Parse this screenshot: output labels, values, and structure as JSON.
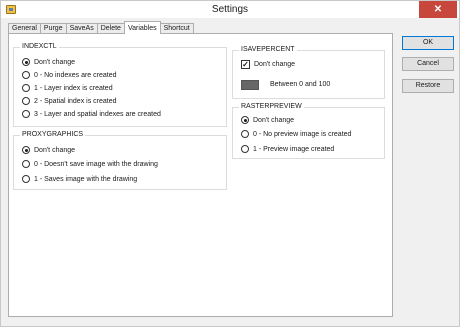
{
  "window": {
    "title": "Settings",
    "close_glyph": "✕",
    "app_icon": "settings-app-icon"
  },
  "tabs": [
    {
      "label": "General",
      "active": false
    },
    {
      "label": "Purge",
      "active": false
    },
    {
      "label": "SaveAs",
      "active": false
    },
    {
      "label": "Delete",
      "active": false
    },
    {
      "label": "Variables",
      "active": true
    },
    {
      "label": "Shortcut",
      "active": false
    }
  ],
  "indexctl": {
    "title": "INDEXCTL",
    "options": [
      {
        "label": "Don't change",
        "checked": true
      },
      {
        "label": "0 - No indexes are created",
        "checked": false
      },
      {
        "label": "1 - Layer index is created",
        "checked": false
      },
      {
        "label": "2 - Spatial index is created",
        "checked": false
      },
      {
        "label": "3 - Layer and spatial indexes are created",
        "checked": false
      }
    ]
  },
  "proxygraphics": {
    "title": "PROXYGRAPHICS",
    "options": [
      {
        "label": "Don't change",
        "checked": true
      },
      {
        "label": "0 - Doesn't save image with the drawing",
        "checked": false
      },
      {
        "label": "1 - Saves image with the drawing",
        "checked": false
      }
    ]
  },
  "isavepercent": {
    "title": "ISAVEPERCENT",
    "checkbox_label": "Don't change",
    "checkbox_checked": true,
    "checkmark": "✓",
    "swatch_color": "#666666",
    "range_label": "Between 0 and 100"
  },
  "rasterpreview": {
    "title": "RASTERPREVIEW",
    "options": [
      {
        "label": "Don't change",
        "checked": true
      },
      {
        "label": "0 - No preview image is created",
        "checked": false
      },
      {
        "label": "1 - Preview image created",
        "checked": false
      }
    ]
  },
  "buttons": {
    "ok": "OK",
    "cancel": "Cancel",
    "restore": "Restore"
  },
  "colors": {
    "close_button": "#c7473c",
    "default_button_border": "#0078d7"
  }
}
